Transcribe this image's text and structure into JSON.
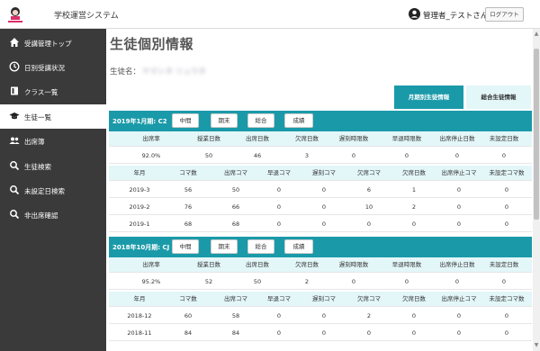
{
  "app": {
    "title": "学校運営システム",
    "logo": "school-logo"
  },
  "header": {
    "user_name": "管理者_テストさん",
    "logout_label": "ログアウト"
  },
  "sidebar": {
    "items": [
      {
        "label": "受講管理トップ",
        "icon": "home-icon",
        "active": false
      },
      {
        "label": "日別受講状況",
        "icon": "clock-icon",
        "active": false
      },
      {
        "label": "クラス一覧",
        "icon": "book-icon",
        "active": false
      },
      {
        "label": "生徒一覧",
        "icon": "graduation-cap-icon",
        "active": true
      },
      {
        "label": "出席簿",
        "icon": "users-icon",
        "active": false
      },
      {
        "label": "生徒検索",
        "icon": "search-icon",
        "active": false
      },
      {
        "label": "未設定日検索",
        "icon": "search-icon",
        "active": false
      },
      {
        "label": "非出席確認",
        "icon": "search-icon",
        "active": false
      }
    ]
  },
  "main": {
    "title": "生徒個別情報",
    "student_label": "生徒名：",
    "student_name": "ヤマシタ リュウタ",
    "tabs": [
      {
        "label": "月期別生徒情報",
        "active": true
      },
      {
        "label": "総合生徒情報",
        "active": false
      }
    ],
    "section_buttons": [
      "中間",
      "期末",
      "総合",
      "成績"
    ],
    "summary_headers": [
      "出席率",
      "授業日数",
      "出席日数",
      "欠席日数",
      "遅刻時限数",
      "早退時限数",
      "出席停止日数",
      "未設定日数"
    ],
    "monthly_headers": [
      "年月",
      "コマ数",
      "出席コマ",
      "早退コマ",
      "遅刻コマ",
      "欠席コマ",
      "欠席日数",
      "出席停止コマ",
      "未設定コマ数"
    ],
    "sections": [
      {
        "title": "2019年1月期: C2",
        "summary": [
          "92.0%",
          "50",
          "46",
          "3",
          "0",
          "0",
          "0",
          "0"
        ],
        "months": [
          [
            "2019-3",
            "56",
            "50",
            "0",
            "0",
            "6",
            "1",
            "0",
            "0"
          ],
          [
            "2019-2",
            "76",
            "66",
            "0",
            "0",
            "10",
            "2",
            "0",
            "0"
          ],
          [
            "2019-1",
            "68",
            "68",
            "0",
            "0",
            "0",
            "0",
            "0",
            "0"
          ]
        ]
      },
      {
        "title": "2018年10月期: CJ",
        "summary": [
          "95.2%",
          "52",
          "50",
          "2",
          "0",
          "0",
          "0",
          "0"
        ],
        "months": [
          [
            "2018-12",
            "60",
            "58",
            "0",
            "0",
            "2",
            "0",
            "0",
            "0"
          ],
          [
            "2018-11",
            "84",
            "84",
            "0",
            "0",
            "0",
            "0",
            "0",
            "0"
          ]
        ]
      }
    ]
  },
  "colors": {
    "accent": "#1a9aa9",
    "header_row": "#e3f6f8",
    "sidebar": "#3a3a3a"
  }
}
